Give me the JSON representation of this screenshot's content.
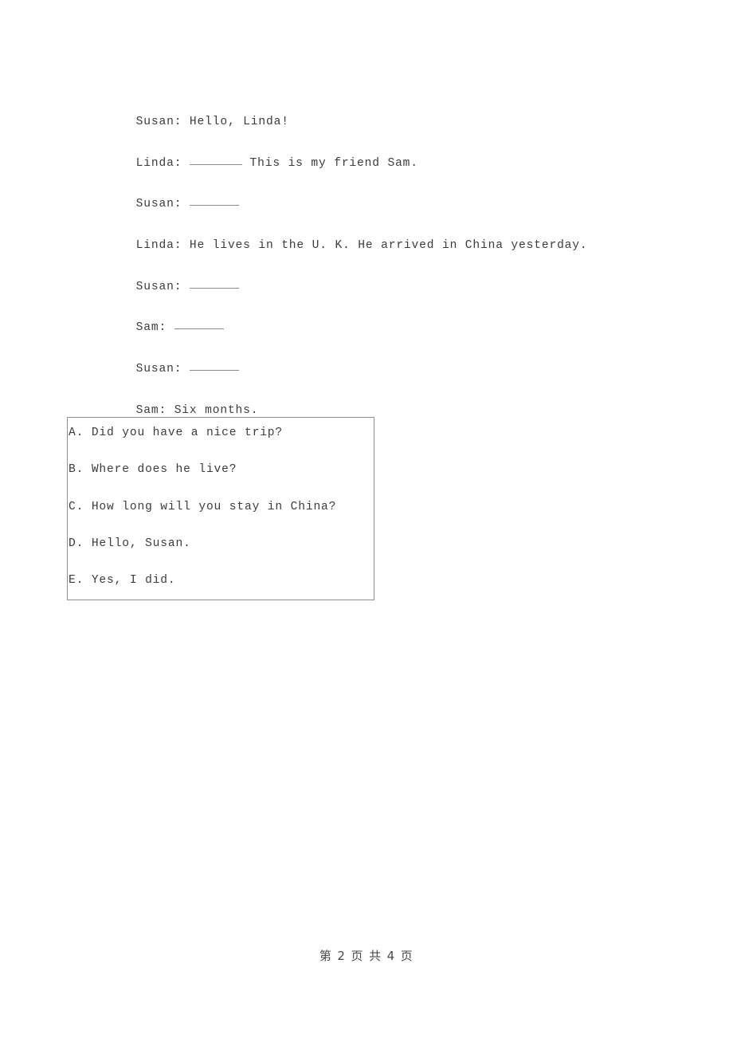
{
  "document": {
    "type": "worksheet-page",
    "background_color": "#ffffff",
    "text_color": "#3c3c3c"
  },
  "dialogue": {
    "lines": [
      {
        "speaker": "Susan:",
        "text": " Hello, Linda!",
        "blank": "none",
        "after_blank": ""
      },
      {
        "speaker": "Linda:",
        "text": " ",
        "blank": "mid",
        "after_blank": " This is my friend Sam."
      },
      {
        "speaker": "Susan:",
        "text": " ",
        "blank": "short",
        "after_blank": ""
      },
      {
        "speaker": "Linda:",
        "text": " He lives in the U. K. He arrived in China yesterday.",
        "blank": "none",
        "after_blank": ""
      },
      {
        "speaker": "Susan:",
        "text": " ",
        "blank": "short",
        "after_blank": ""
      },
      {
        "speaker": "Sam:",
        "text": " ",
        "blank": "short",
        "after_blank": ""
      },
      {
        "speaker": "Susan:",
        "text": " ",
        "blank": "short",
        "after_blank": ""
      },
      {
        "speaker": "Sam:",
        "text": " Six months.",
        "blank": "none",
        "after_blank": ""
      }
    ],
    "full_lines": [
      "Susan: Hello, Linda!",
      "Linda: ________ This is my friend Sam.",
      "Susan: ________",
      "Linda: He lives in the U. K. He arrived in China yesterday.",
      "Susan: ________",
      "Sam: ________",
      "Susan: ________",
      "Sam: Six months."
    ]
  },
  "options_box": {
    "border_color": "#8f8f8f",
    "options": [
      {
        "letter": "A.",
        "text": " Did you have a nice trip?"
      },
      {
        "letter": "B.",
        "text": " Where does he live?"
      },
      {
        "letter": "C.",
        "text": " How long will you stay in China?"
      },
      {
        "letter": "D.",
        "text": " Hello, Susan."
      },
      {
        "letter": "E.",
        "text": " Yes, I did."
      }
    ],
    "full_options": [
      "A. Did you have a nice trip?",
      "B. Where does he live?",
      "C. How long will you stay in China?",
      "D. Hello, Susan.",
      "E. Yes, I did."
    ]
  },
  "footer": {
    "text": "第 2 页 共 4 页",
    "current_page": "2",
    "total_pages": "4"
  }
}
